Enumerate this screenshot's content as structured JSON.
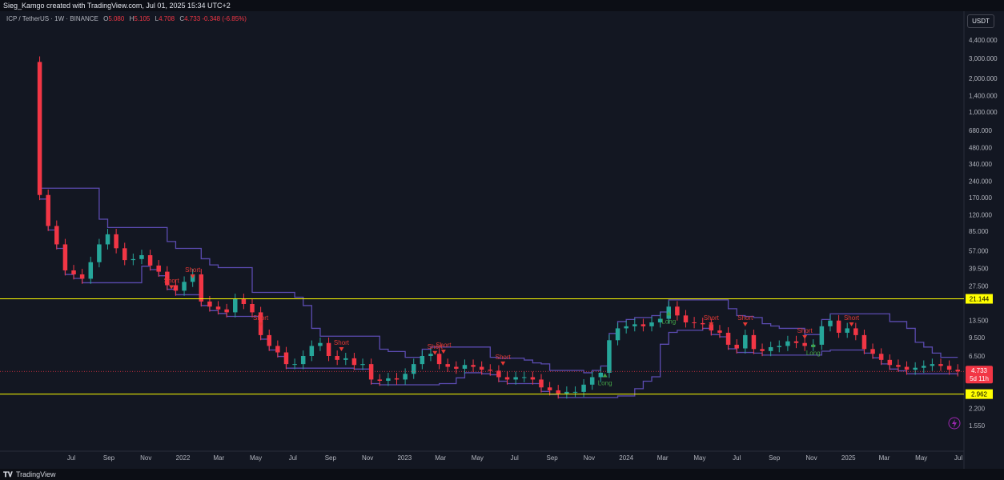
{
  "header": {
    "attribution": "Sieg_Kamgo created with TradingView.com, Jul 01, 2025 15:34 UTC+2"
  },
  "legend": {
    "symbol": "ICP / TetherUS · 1W · BINANCE",
    "open_label": "O",
    "open_value": "5.080",
    "high_label": "H",
    "high_value": "5.105",
    "low_label": "L",
    "low_value": "4.708",
    "close_label": "C",
    "close_value": "4.733",
    "change": "-0.348 (-6.85%)"
  },
  "currency_button": "USDT",
  "footer": {
    "logo_icon": "tradingview-logo-icon",
    "brand": "TradingView"
  },
  "colors": {
    "background": "#131722",
    "up": "#26a69a",
    "down": "#f23645",
    "band": "#5b4bb0",
    "level_line": "#ffff00",
    "price_tag": "#f23645"
  },
  "chart_data": {
    "type": "candlestick",
    "scale": "log",
    "ylim": [
      1.4,
      4400000
    ],
    "y_ticks": [
      "4,400.000",
      "3,000.000",
      "2,000.000",
      "1,400.000",
      "1,000.000",
      "680.000",
      "480.000",
      "340.000",
      "240.000",
      "170.000",
      "120.000",
      "85.000",
      "57.000",
      "39.500",
      "27.500",
      "13.500",
      "9.500",
      "6.500",
      "2.200",
      "1.550"
    ],
    "y_tick_values": [
      4400,
      3000,
      2000,
      1400,
      1000,
      680,
      480,
      340,
      240,
      170,
      120,
      85,
      57,
      39.5,
      27.5,
      13.5,
      9.5,
      6.5,
      2.2,
      1.55
    ],
    "x_ticks": [
      {
        "label": "Jul",
        "date": "2021-07-01"
      },
      {
        "label": "Sep",
        "date": "2021-09-01"
      },
      {
        "label": "Nov",
        "date": "2021-11-01"
      },
      {
        "label": "2022",
        "date": "2022-01-01"
      },
      {
        "label": "Mar",
        "date": "2022-03-01"
      },
      {
        "label": "May",
        "date": "2022-05-01"
      },
      {
        "label": "Jul",
        "date": "2022-07-01"
      },
      {
        "label": "Sep",
        "date": "2022-09-01"
      },
      {
        "label": "Nov",
        "date": "2022-11-01"
      },
      {
        "label": "2023",
        "date": "2023-01-01"
      },
      {
        "label": "Mar",
        "date": "2023-03-01"
      },
      {
        "label": "May",
        "date": "2023-05-01"
      },
      {
        "label": "Jul",
        "date": "2023-07-01"
      },
      {
        "label": "Sep",
        "date": "2023-09-01"
      },
      {
        "label": "Nov",
        "date": "2023-11-01"
      },
      {
        "label": "2024",
        "date": "2024-01-01"
      },
      {
        "label": "Mar",
        "date": "2024-03-01"
      },
      {
        "label": "May",
        "date": "2024-05-01"
      },
      {
        "label": "Jul",
        "date": "2024-07-01"
      },
      {
        "label": "Sep",
        "date": "2024-09-01"
      },
      {
        "label": "Nov",
        "date": "2024-11-01"
      },
      {
        "label": "2025",
        "date": "2025-01-01"
      },
      {
        "label": "Mar",
        "date": "2025-03-01"
      },
      {
        "label": "May",
        "date": "2025-05-01"
      },
      {
        "label": "Jul",
        "date": "2025-07-01"
      }
    ],
    "closes": [
      {
        "date": "2021-05-10",
        "close": 180
      },
      {
        "date": "2021-05-24",
        "close": 95
      },
      {
        "date": "2021-06-07",
        "close": 65
      },
      {
        "date": "2021-06-21",
        "close": 38
      },
      {
        "date": "2021-07-05",
        "close": 35
      },
      {
        "date": "2021-07-19",
        "close": 32
      },
      {
        "date": "2021-08-02",
        "close": 45
      },
      {
        "date": "2021-08-16",
        "close": 65
      },
      {
        "date": "2021-08-30",
        "close": 80
      },
      {
        "date": "2021-09-13",
        "close": 60
      },
      {
        "date": "2021-09-27",
        "close": 47
      },
      {
        "date": "2021-10-11",
        "close": 48
      },
      {
        "date": "2021-10-25",
        "close": 52
      },
      {
        "date": "2021-11-08",
        "close": 42
      },
      {
        "date": "2021-11-22",
        "close": 37
      },
      {
        "date": "2021-12-06",
        "close": 28
      },
      {
        "date": "2021-12-20",
        "close": 25
      },
      {
        "date": "2022-01-03",
        "close": 30
      },
      {
        "date": "2022-01-17",
        "close": 35
      },
      {
        "date": "2022-01-31",
        "close": 20
      },
      {
        "date": "2022-02-14",
        "close": 18
      },
      {
        "date": "2022-02-28",
        "close": 17
      },
      {
        "date": "2022-03-14",
        "close": 16
      },
      {
        "date": "2022-03-28",
        "close": 21
      },
      {
        "date": "2022-04-11",
        "close": 19
      },
      {
        "date": "2022-04-25",
        "close": 16
      },
      {
        "date": "2022-05-09",
        "close": 10
      },
      {
        "date": "2022-05-23",
        "close": 8
      },
      {
        "date": "2022-06-06",
        "close": 7
      },
      {
        "date": "2022-06-20",
        "close": 5.5
      },
      {
        "date": "2022-07-04",
        "close": 5.5
      },
      {
        "date": "2022-07-18",
        "close": 6.5
      },
      {
        "date": "2022-08-01",
        "close": 8
      },
      {
        "date": "2022-08-15",
        "close": 8.5
      },
      {
        "date": "2022-08-29",
        "close": 6.5
      },
      {
        "date": "2022-09-12",
        "close": 6
      },
      {
        "date": "2022-09-26",
        "close": 6.2
      },
      {
        "date": "2022-10-10",
        "close": 5.4
      },
      {
        "date": "2022-10-24",
        "close": 5.5
      },
      {
        "date": "2022-11-07",
        "close": 4
      },
      {
        "date": "2022-11-21",
        "close": 3.9
      },
      {
        "date": "2022-12-05",
        "close": 4.1
      },
      {
        "date": "2022-12-19",
        "close": 4
      },
      {
        "date": "2023-01-02",
        "close": 4.5
      },
      {
        "date": "2023-01-16",
        "close": 5.5
      },
      {
        "date": "2023-01-30",
        "close": 6.5
      },
      {
        "date": "2023-02-13",
        "close": 6.8
      },
      {
        "date": "2023-02-27",
        "close": 5.5
      },
      {
        "date": "2023-03-13",
        "close": 5.2
      },
      {
        "date": "2023-03-27",
        "close": 5
      },
      {
        "date": "2023-04-10",
        "close": 5.4
      },
      {
        "date": "2023-04-24",
        "close": 5.2
      },
      {
        "date": "2023-05-08",
        "close": 4.9
      },
      {
        "date": "2023-05-22",
        "close": 4.8
      },
      {
        "date": "2023-06-05",
        "close": 4.2
      },
      {
        "date": "2023-06-19",
        "close": 4
      },
      {
        "date": "2023-07-03",
        "close": 4.2
      },
      {
        "date": "2023-07-17",
        "close": 4.2
      },
      {
        "date": "2023-07-31",
        "close": 4
      },
      {
        "date": "2023-08-14",
        "close": 3.4
      },
      {
        "date": "2023-08-28",
        "close": 3.2
      },
      {
        "date": "2023-09-11",
        "close": 3
      },
      {
        "date": "2023-09-25",
        "close": 3.1
      },
      {
        "date": "2023-10-09",
        "close": 3.1
      },
      {
        "date": "2023-10-23",
        "close": 3.6
      },
      {
        "date": "2023-11-06",
        "close": 4.2
      },
      {
        "date": "2023-11-20",
        "close": 4.6
      },
      {
        "date": "2023-12-04",
        "close": 9
      },
      {
        "date": "2023-12-18",
        "close": 11.5
      },
      {
        "date": "2024-01-01",
        "close": 12
      },
      {
        "date": "2024-01-15",
        "close": 12.5
      },
      {
        "date": "2024-01-29",
        "close": 12
      },
      {
        "date": "2024-02-12",
        "close": 13
      },
      {
        "date": "2024-02-26",
        "close": 14
      },
      {
        "date": "2024-03-11",
        "close": 18
      },
      {
        "date": "2024-03-25",
        "close": 15
      },
      {
        "date": "2024-04-08",
        "close": 13
      },
      {
        "date": "2024-04-22",
        "close": 12.8
      },
      {
        "date": "2024-05-06",
        "close": 12.5
      },
      {
        "date": "2024-05-20",
        "close": 11
      },
      {
        "date": "2024-06-03",
        "close": 10.5
      },
      {
        "date": "2024-06-17",
        "close": 8.2
      },
      {
        "date": "2024-07-01",
        "close": 7.6
      },
      {
        "date": "2024-07-15",
        "close": 10
      },
      {
        "date": "2024-07-29",
        "close": 7.5
      },
      {
        "date": "2024-08-12",
        "close": 7.2
      },
      {
        "date": "2024-08-26",
        "close": 7.8
      },
      {
        "date": "2024-09-09",
        "close": 8
      },
      {
        "date": "2024-09-23",
        "close": 8.8
      },
      {
        "date": "2024-10-07",
        "close": 8.5
      },
      {
        "date": "2024-10-21",
        "close": 8
      },
      {
        "date": "2024-11-04",
        "close": 8.2
      },
      {
        "date": "2024-11-18",
        "close": 12
      },
      {
        "date": "2024-12-02",
        "close": 13.5
      },
      {
        "date": "2024-12-16",
        "close": 10.5
      },
      {
        "date": "2024-12-30",
        "close": 11.5
      },
      {
        "date": "2025-01-13",
        "close": 10
      },
      {
        "date": "2025-01-27",
        "close": 7.5
      },
      {
        "date": "2025-02-10",
        "close": 6.8
      },
      {
        "date": "2025-02-24",
        "close": 6
      },
      {
        "date": "2025-03-10",
        "close": 5.4
      },
      {
        "date": "2025-03-24",
        "close": 5.2
      },
      {
        "date": "2025-04-07",
        "close": 4.9
      },
      {
        "date": "2025-04-21",
        "close": 5.1
      },
      {
        "date": "2025-05-05",
        "close": 5.3
      },
      {
        "date": "2025-05-19",
        "close": 5.5
      },
      {
        "date": "2025-06-02",
        "close": 5.3
      },
      {
        "date": "2025-06-16",
        "close": 4.9
      },
      {
        "date": "2025-06-30",
        "close": 4.733
      }
    ],
    "horizontal_levels": [
      {
        "label": "21.144",
        "value": 21.144
      },
      {
        "label": "2.962",
        "value": 2.962
      }
    ],
    "last_price": {
      "label": "4.733",
      "value": 4.733,
      "countdown": "5d 11h"
    },
    "signals": [
      {
        "text": "Short",
        "date": "2021-12-13",
        "price": 28
      },
      {
        "text": "Short",
        "date": "2022-01-17",
        "price": 35
      },
      {
        "text": "Short",
        "date": "2022-05-09",
        "price": 13
      },
      {
        "text": "Short",
        "date": "2022-09-19",
        "price": 7.8
      },
      {
        "text": "Short",
        "date": "2023-02-20",
        "price": 7.2
      },
      {
        "text": "Short",
        "date": "2023-03-06",
        "price": 7.4
      },
      {
        "text": "Short",
        "date": "2023-06-12",
        "price": 5.8
      },
      {
        "text": "Long",
        "date": "2023-11-27",
        "price": 4.2
      },
      {
        "text": "Long",
        "date": "2024-03-11",
        "price": 15
      },
      {
        "text": "Short",
        "date": "2024-05-20",
        "price": 13
      },
      {
        "text": "Short",
        "date": "2024-07-15",
        "price": 13
      },
      {
        "text": "Short",
        "date": "2024-10-21",
        "price": 10
      },
      {
        "text": "Long",
        "date": "2024-11-04",
        "price": 7.8
      },
      {
        "text": "Short",
        "date": "2025-01-06",
        "price": 13
      }
    ]
  }
}
